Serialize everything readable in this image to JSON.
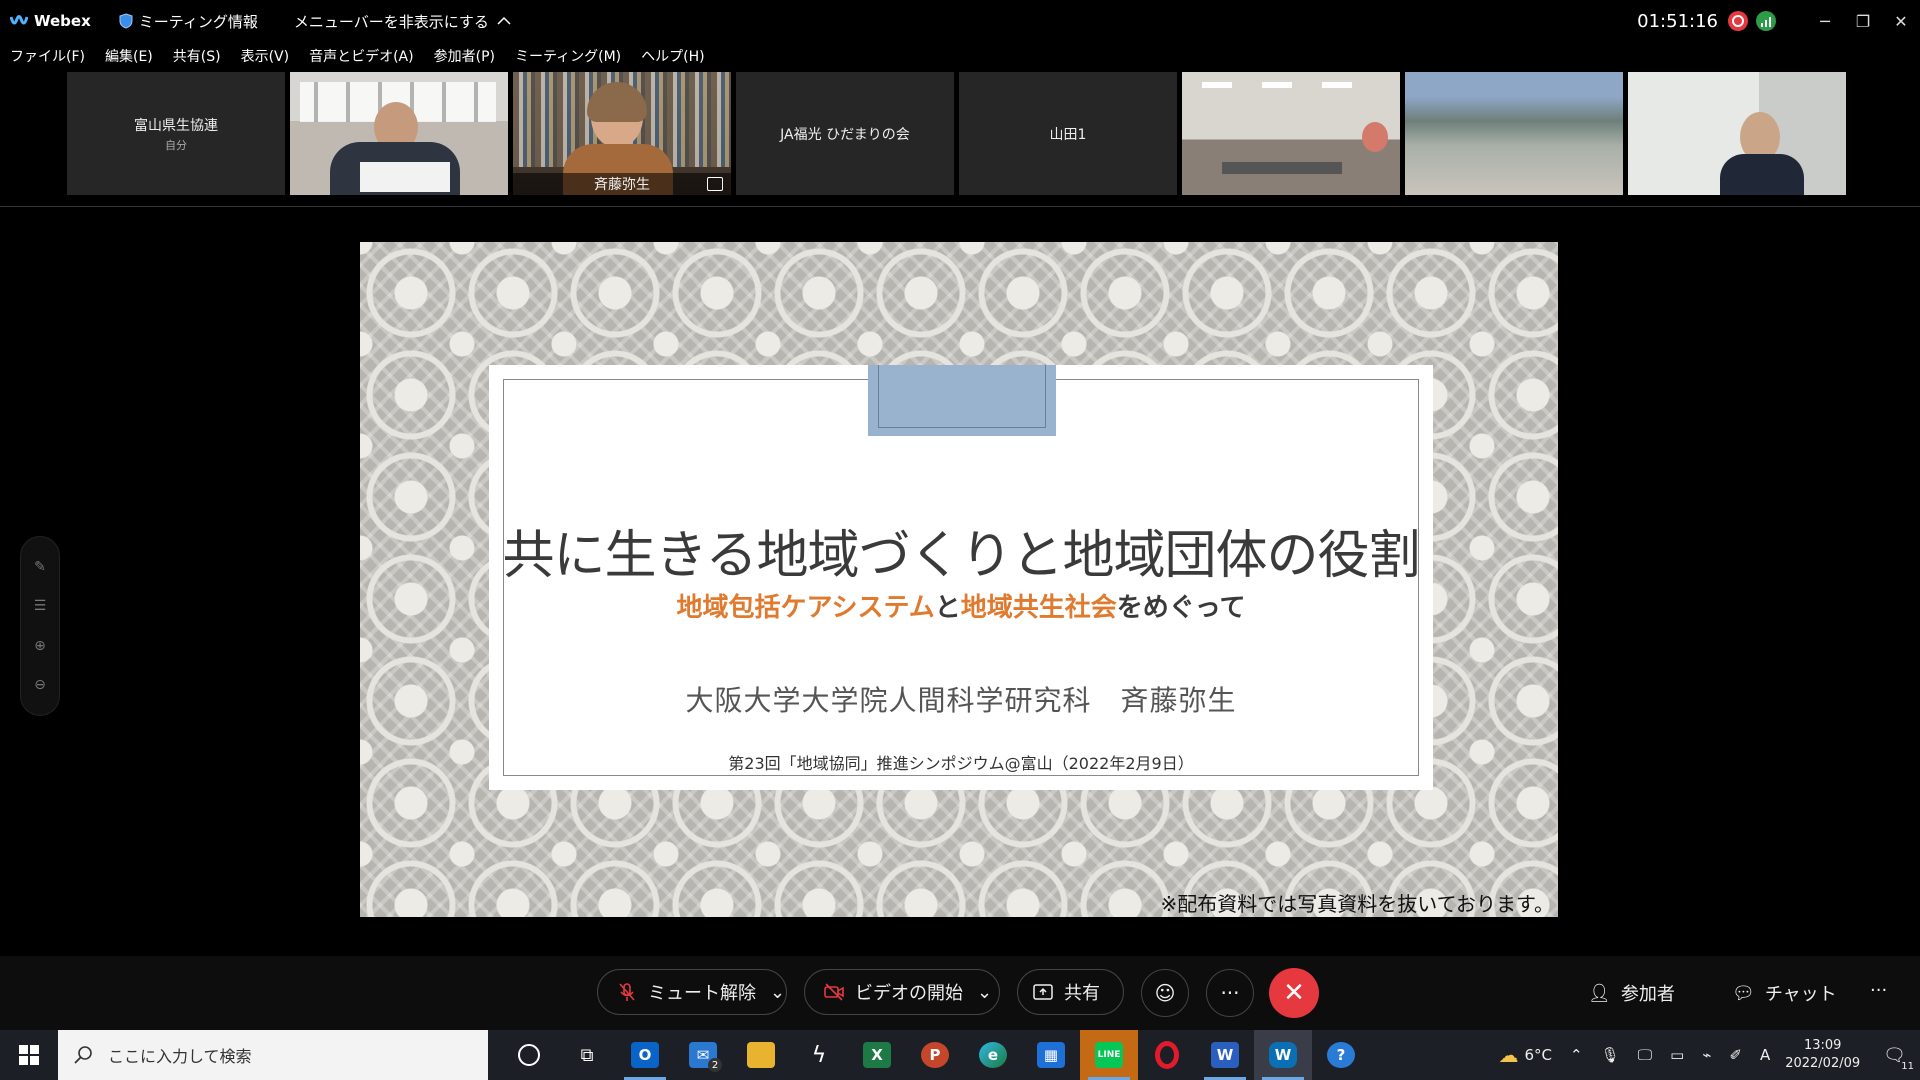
{
  "window": {
    "app_name": "Webex",
    "meeting_info_label": "ミーティング情報",
    "hide_menubar_label": "メニューバーを非表示にする",
    "timer": "01:51:16"
  },
  "menu": [
    "ファイル(F)",
    "編集(E)",
    "共有(S)",
    "表示(V)",
    "音声とビデオ(A)",
    "参加者(P)",
    "ミーティング(M)",
    "ヘルプ(H)"
  ],
  "participants": [
    {
      "name": "富山県生協連",
      "sub": "自分",
      "type": "text"
    },
    {
      "name": "",
      "sub": "",
      "type": "video"
    },
    {
      "name": "斉藤弥生",
      "sub": "",
      "type": "video-active"
    },
    {
      "name": "JA福光 ひだまりの会",
      "sub": "",
      "type": "text"
    },
    {
      "name": "山田1",
      "sub": "",
      "type": "text"
    },
    {
      "name": "",
      "sub": "",
      "type": "video"
    },
    {
      "name": "",
      "sub": "",
      "type": "video"
    },
    {
      "name": "",
      "sub": "",
      "type": "video"
    }
  ],
  "slide": {
    "title": "共に生きる地域づくりと地域団体の役割",
    "subtitle_hl1": "地域包括ケアシステム",
    "subtitle_mid": "と",
    "subtitle_hl2": "地域共生社会",
    "subtitle_end": "をめぐって",
    "author": "大阪大学大学院人間科学研究科　斉藤弥生",
    "event": "第23回「地域協同」推進シンポジウム@富山（2022年2月9日）",
    "note": "※配布資料では写真資料を抜いております。",
    "accent_color": "#e07a2f"
  },
  "controls": {
    "unmute": "ミュート解除",
    "start_video": "ビデオの開始",
    "share": "共有",
    "participants": "参加者",
    "chat": "チャット"
  },
  "taskbar": {
    "search_placeholder": "ここに入力して検索",
    "mail_badge": "2",
    "weather": "6°C",
    "ime": "A",
    "time": "13:09",
    "date": "2022/02/09",
    "notif_count": "11"
  }
}
